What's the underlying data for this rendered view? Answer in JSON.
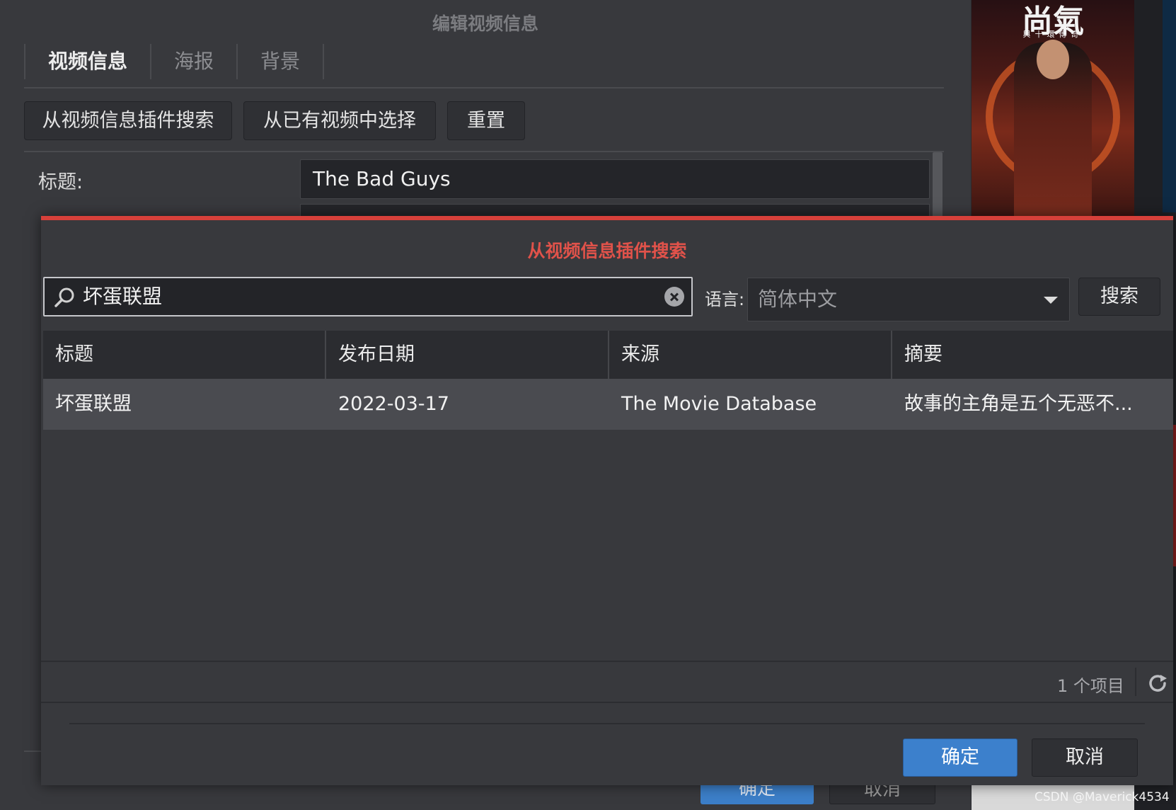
{
  "background_window": {
    "title": "编辑视频信息",
    "tabs": [
      {
        "label": "视频信息",
        "active": true
      },
      {
        "label": "海报",
        "active": false
      },
      {
        "label": "背景",
        "active": false
      }
    ],
    "buttons": {
      "search_plugin": "从视频信息插件搜索",
      "choose_existing": "从已有视频中选择",
      "reset": "重置"
    },
    "form": {
      "title_label": "标题:",
      "title_value": "The Bad Guys"
    },
    "bottom": {
      "ok": "确定",
      "cancel": "取消"
    }
  },
  "poster": {
    "title": "尚氣",
    "subtitle": "與十環傳奇"
  },
  "dialog": {
    "title": "从视频信息插件搜索",
    "accent_color": "#d6403a",
    "search": {
      "value": "坏蛋联盟",
      "icon": "search-icon",
      "clear_icon": "close-icon"
    },
    "language": {
      "label": "语言:",
      "selected": "简体中文"
    },
    "search_button": "搜索",
    "table": {
      "columns": [
        "标题",
        "发布日期",
        "来源",
        "摘要"
      ],
      "rows": [
        {
          "title": "坏蛋联盟",
          "date": "2022-03-17",
          "source": "The Movie Database",
          "summary": "故事的主角是五个无恶不..."
        }
      ]
    },
    "footer": {
      "item_count": "1 个项目",
      "refresh_icon": "refresh-icon"
    },
    "ok_button": "确定",
    "cancel_button": "取消"
  },
  "watermark": "CSDN @Maverick4534"
}
